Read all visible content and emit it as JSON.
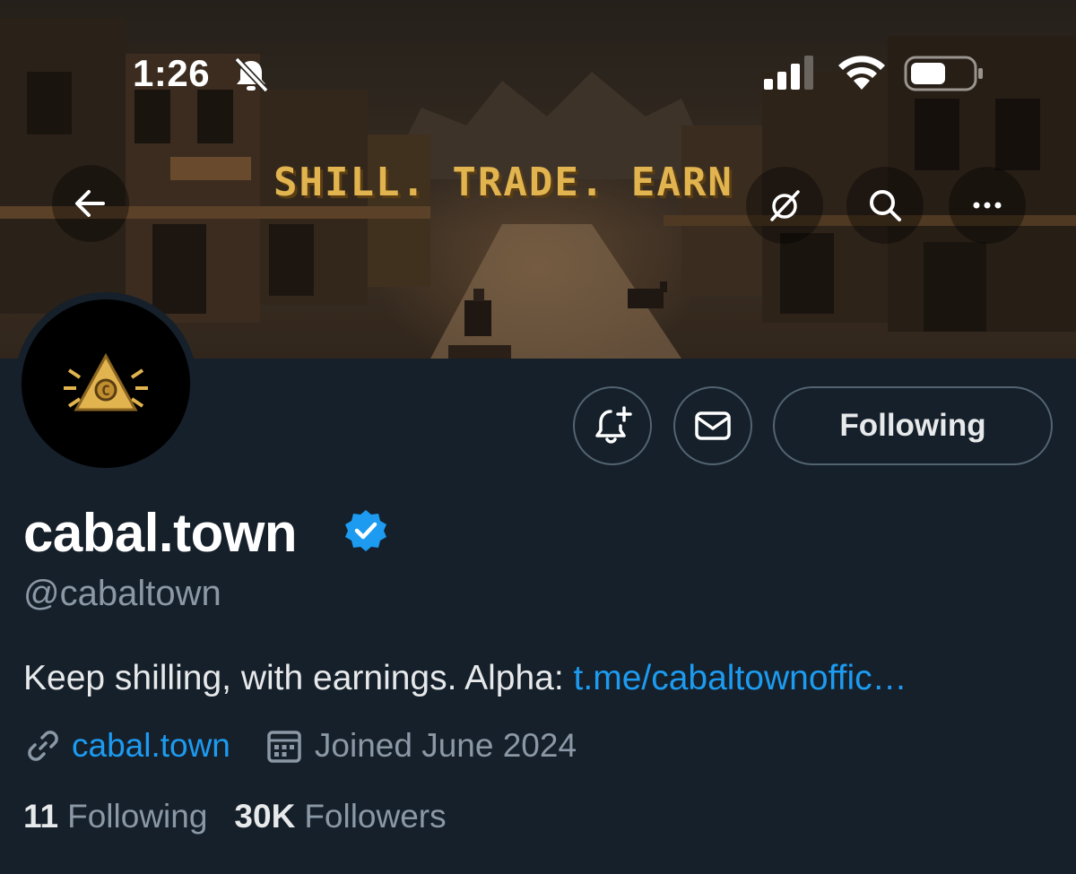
{
  "status_bar": {
    "time": "1:26",
    "mute_icon": "bell-slash-icon",
    "signal_icon": "cellular-signal-icon",
    "wifi_icon": "wifi-icon",
    "battery_icon": "battery-icon"
  },
  "banner": {
    "text": "SHILL. TRADE. EARN",
    "text_color": "#e2b44f"
  },
  "nav": {
    "back_icon": "arrow-left-icon",
    "grok_icon": "grok-icon",
    "search_icon": "search-icon",
    "more_icon": "ellipsis-icon"
  },
  "actions": {
    "notify_icon": "bell-plus-icon",
    "message_icon": "envelope-icon",
    "following_label": "Following"
  },
  "profile": {
    "display_name": "cabal.town",
    "handle": "@cabaltown",
    "bio_text": "Keep shilling, with earnings. Alpha: ",
    "bio_link": "t.me/cabaltownoffic…",
    "website": "cabal.town",
    "joined": "Joined June 2024",
    "verified_color": "#1d9bf0"
  },
  "stats": {
    "following_count": "11",
    "following_label": "Following",
    "followers_count": "30K",
    "followers_label": "Followers"
  },
  "colors": {
    "background": "#15202b",
    "accent": "#1d9bf0",
    "muted_text": "#8b98a5",
    "border": "#536471"
  }
}
